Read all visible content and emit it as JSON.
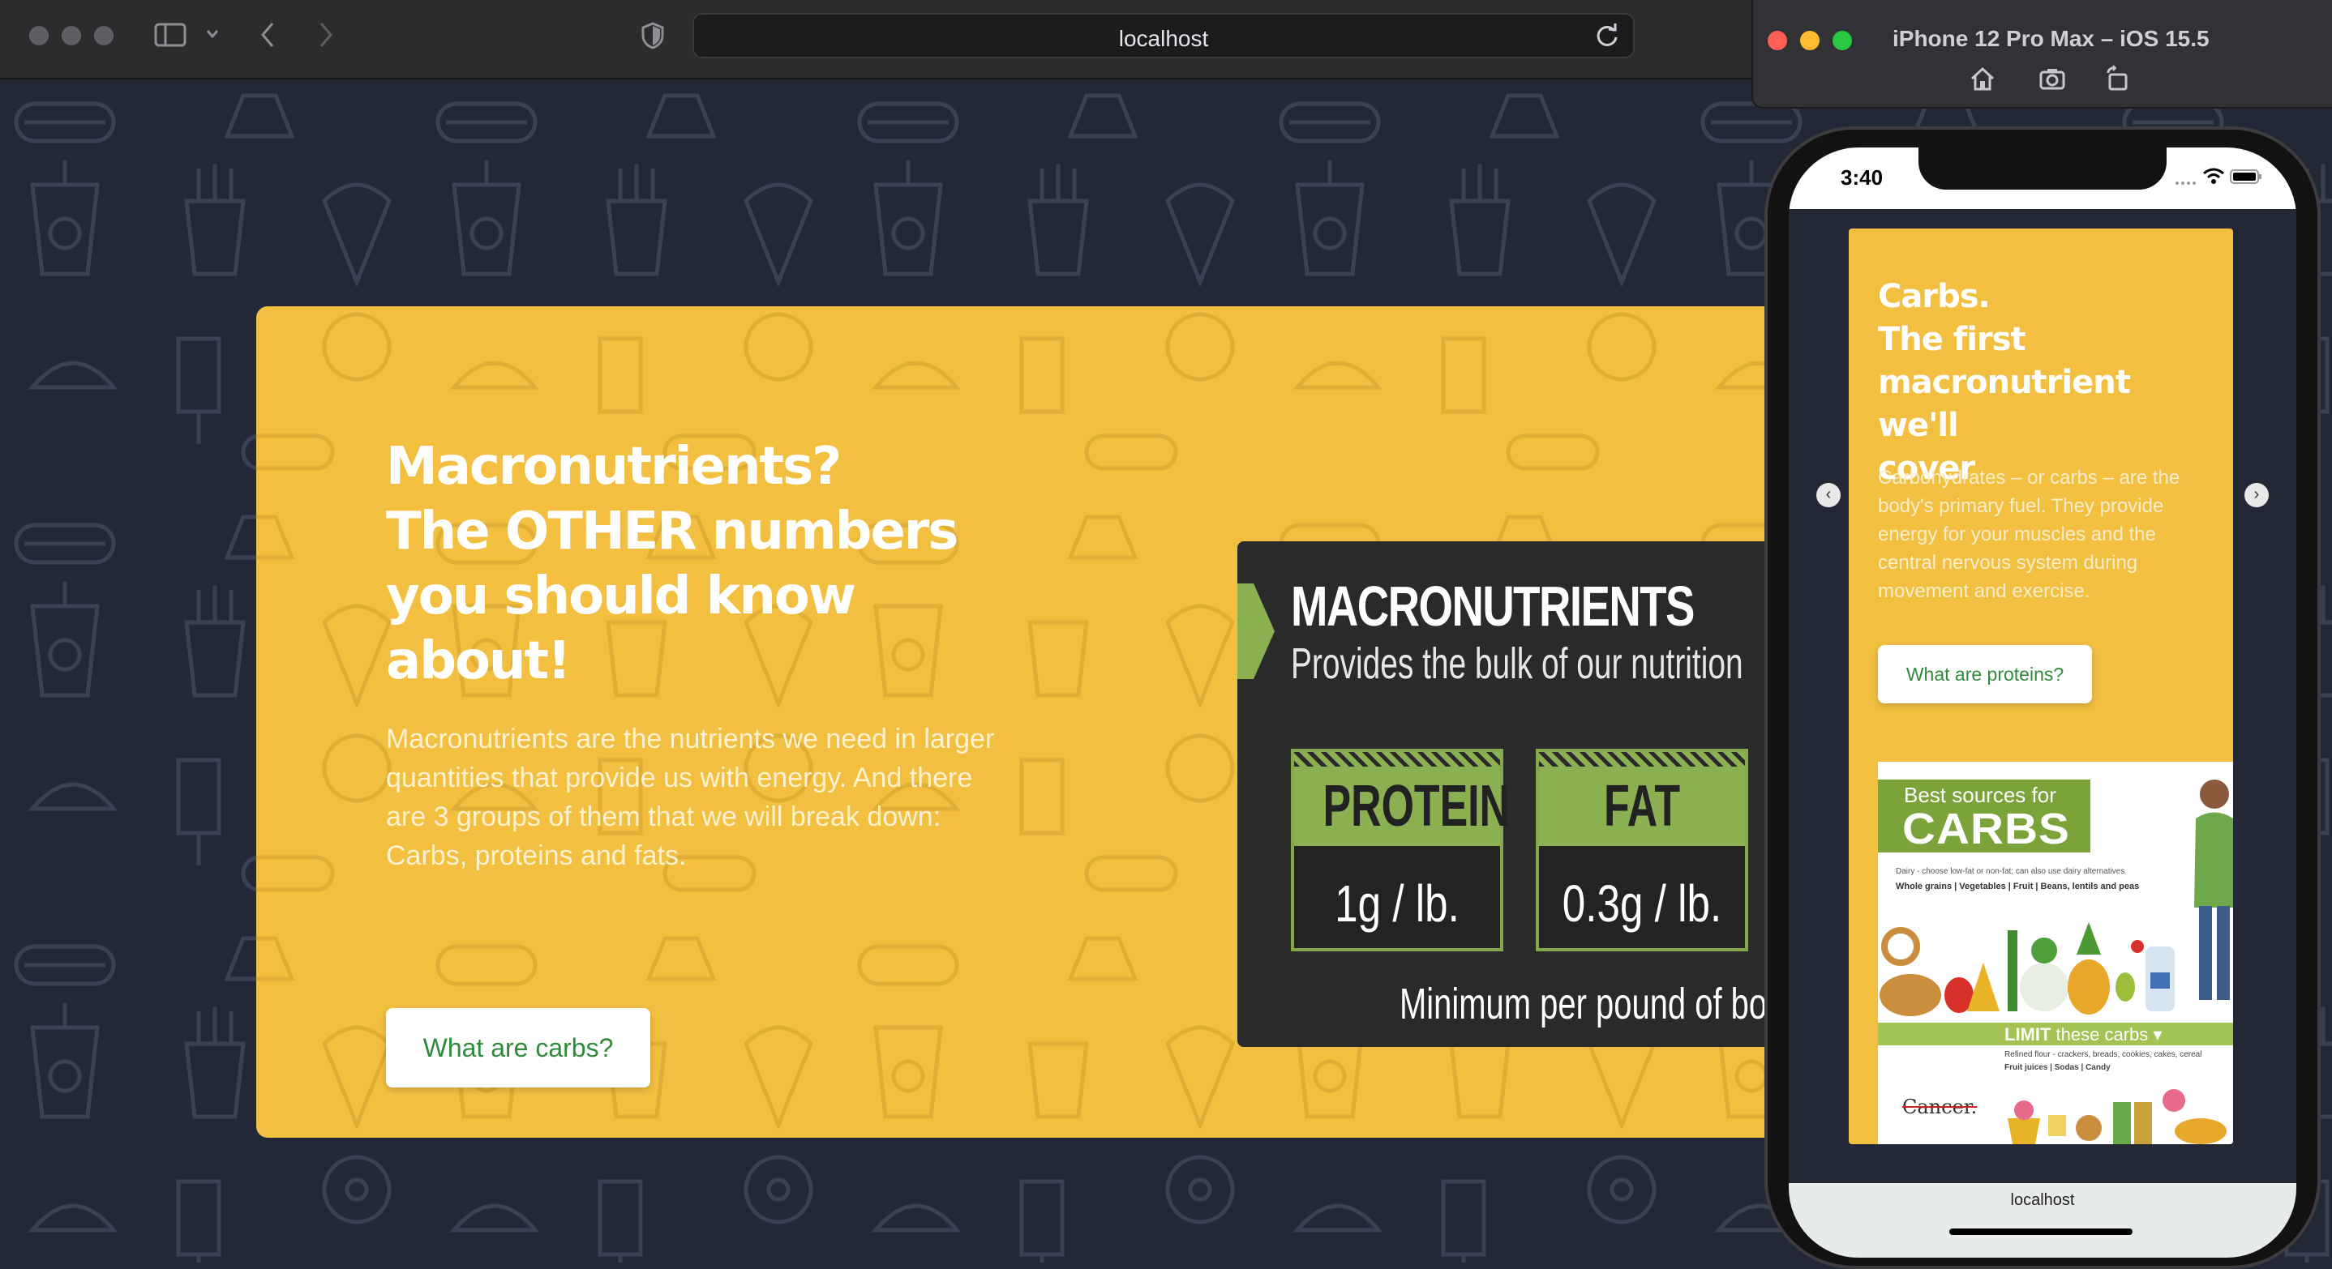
{
  "browser": {
    "address": "localhost",
    "icons": [
      "sidebar-icon",
      "chevron-down-icon",
      "back-icon",
      "forward-icon",
      "shield-icon",
      "reload-icon"
    ]
  },
  "hero": {
    "title_lines": [
      "Macronutrients?",
      "The OTHER numbers",
      "you should know",
      "about!"
    ],
    "body": "Macronutrients are the nutrients we need in larger quantities that provide us with energy. And there are 3 groups of them that we will break down: Carbs, proteins and fats.",
    "button": "What are carbs?"
  },
  "infographic": {
    "title": "MACRONUTRIENTS",
    "subtitle": "Provides the bulk of our nutrition",
    "boxes": [
      {
        "name": "PROTEIN",
        "value": "1g / lb."
      },
      {
        "name": "FAT",
        "value": "0.3g / lb."
      }
    ],
    "footer": "Minimum per pound of boc",
    "accent": "#8ab052"
  },
  "simulator": {
    "title": "iPhone 12 Pro Max – iOS 15.5",
    "icons": [
      "home-icon",
      "screenshot-icon",
      "rotate-icon"
    ]
  },
  "phone": {
    "time": "3:40",
    "card_title_lines": [
      "Carbs.",
      "The first",
      "macronutrient we'll",
      "cover"
    ],
    "card_body": "Carbohydrates – or carbs – are the body's primary fuel. They provide energy for your muscles and the central nervous system during movement and exercise.",
    "card_button": "What are proteins?",
    "carbs_image": {
      "best": "Best sources for",
      "word": "CARBS",
      "dairy": "Dairy - choose low-fat or non-fat; can also use dairy alternatives",
      "grains": "Whole grains | Vegetables | Fruit | Beans, lentils and peas",
      "limit": "LIMIT",
      "limit_rest": " these carbs ▾",
      "refined": "Refined flour - crackers, breads, cookies, cakes, cereal",
      "juices": "Fruit juices | Sodas | Candy",
      "cancer": "Cancer."
    },
    "bottom_url": "localhost"
  },
  "colors": {
    "card": "#f2bf40",
    "background": "#222836",
    "button_text": "#2e8b3a"
  }
}
